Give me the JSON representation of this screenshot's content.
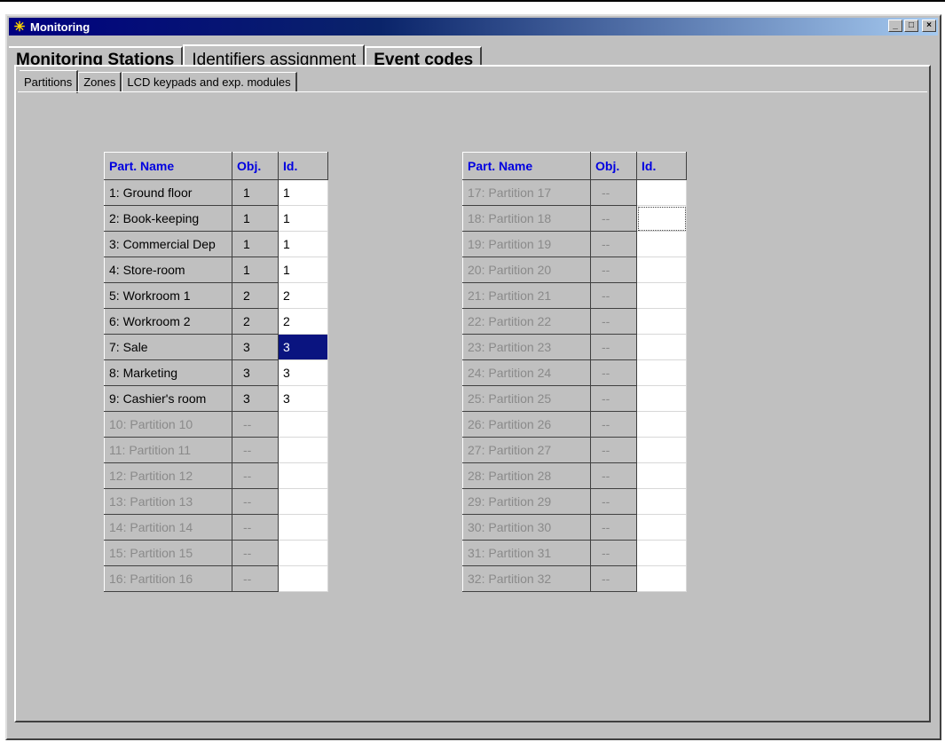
{
  "window": {
    "title": "Monitoring",
    "icon": "asterisk-icon"
  },
  "main_tabs": [
    "Monitoring Stations",
    "Identifiers assignment",
    "Event codes"
  ],
  "active_main_tab": 1,
  "sub_tabs": [
    "Partitions",
    "Zones",
    "LCD keypads and exp. modules"
  ],
  "active_sub_tab": 0,
  "columns": {
    "name": "Part. Name",
    "obj": "Obj.",
    "id": "Id."
  },
  "left_rows": [
    {
      "name": "1: Ground floor",
      "obj": "1",
      "id": "1"
    },
    {
      "name": "2: Book-keeping",
      "obj": "1",
      "id": "1"
    },
    {
      "name": "3: Commercial Dep",
      "obj": "1",
      "id": "1"
    },
    {
      "name": "4: Store-room",
      "obj": "1",
      "id": "1"
    },
    {
      "name": "5: Workroom 1",
      "obj": "2",
      "id": "2"
    },
    {
      "name": "6: Workroom 2",
      "obj": "2",
      "id": "2"
    },
    {
      "name": "7: Sale",
      "obj": "3",
      "id": "3",
      "selected": true
    },
    {
      "name": "8: Marketing",
      "obj": "3",
      "id": "3"
    },
    {
      "name": "9: Cashier's room",
      "obj": "3",
      "id": "3"
    },
    {
      "name": "10: Partition 10",
      "obj": "--",
      "id": "",
      "disabled": true
    },
    {
      "name": "11: Partition 11",
      "obj": "--",
      "id": "",
      "disabled": true
    },
    {
      "name": "12: Partition 12",
      "obj": "--",
      "id": "",
      "disabled": true
    },
    {
      "name": "13: Partition 13",
      "obj": "--",
      "id": "",
      "disabled": true
    },
    {
      "name": "14: Partition 14",
      "obj": "--",
      "id": "",
      "disabled": true
    },
    {
      "name": "15: Partition 15",
      "obj": "--",
      "id": "",
      "disabled": true
    },
    {
      "name": "16: Partition 16",
      "obj": "--",
      "id": "",
      "disabled": true
    }
  ],
  "right_rows": [
    {
      "name": "17: Partition 17",
      "obj": "--",
      "id": "",
      "disabled": true
    },
    {
      "name": "18: Partition 18",
      "obj": "--",
      "id": "",
      "disabled": true,
      "focused": true
    },
    {
      "name": "19: Partition 19",
      "obj": "--",
      "id": "",
      "disabled": true
    },
    {
      "name": "20: Partition 20",
      "obj": "--",
      "id": "",
      "disabled": true
    },
    {
      "name": "21: Partition 21",
      "obj": "--",
      "id": "",
      "disabled": true
    },
    {
      "name": "22: Partition 22",
      "obj": "--",
      "id": "",
      "disabled": true
    },
    {
      "name": "23: Partition 23",
      "obj": "--",
      "id": "",
      "disabled": true
    },
    {
      "name": "24: Partition 24",
      "obj": "--",
      "id": "",
      "disabled": true
    },
    {
      "name": "25: Partition 25",
      "obj": "--",
      "id": "",
      "disabled": true
    },
    {
      "name": "26: Partition 26",
      "obj": "--",
      "id": "",
      "disabled": true
    },
    {
      "name": "27: Partition 27",
      "obj": "--",
      "id": "",
      "disabled": true
    },
    {
      "name": "28: Partition 28",
      "obj": "--",
      "id": "",
      "disabled": true
    },
    {
      "name": "29: Partition 29",
      "obj": "--",
      "id": "",
      "disabled": true
    },
    {
      "name": "30: Partition 30",
      "obj": "--",
      "id": "",
      "disabled": true
    },
    {
      "name": "31: Partition 31",
      "obj": "--",
      "id": "",
      "disabled": true
    },
    {
      "name": "32: Partition 32",
      "obj": "--",
      "id": "",
      "disabled": true
    }
  ],
  "colors": {
    "titlebar": "#000080",
    "header_text": "#0000e0",
    "selection": "#0a1480"
  }
}
